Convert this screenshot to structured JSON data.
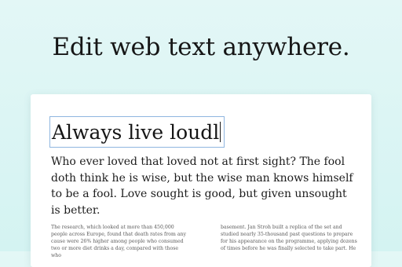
{
  "headline": "Edit web text anywhere.",
  "card": {
    "title_input": "Always live loudl",
    "lead_paragraph": "Who ever loved that loved not at first sight? The fool doth think he is wise, but the wise man knows himself to be a fool. Love sought is good, but given unsought is better.",
    "column_left": "The research, which looked at more than 450,000 people across Europe, found that death rates from any cause were 26% higher among people who consumed two or more diet drinks a day, compared with those who",
    "column_right": "basement. Jan Stroh built a replica of the set and studied nearly 35-thousand past questions to prepare for his appearance on the programme, applying dozens of times before he was finally selected to take part. He"
  }
}
